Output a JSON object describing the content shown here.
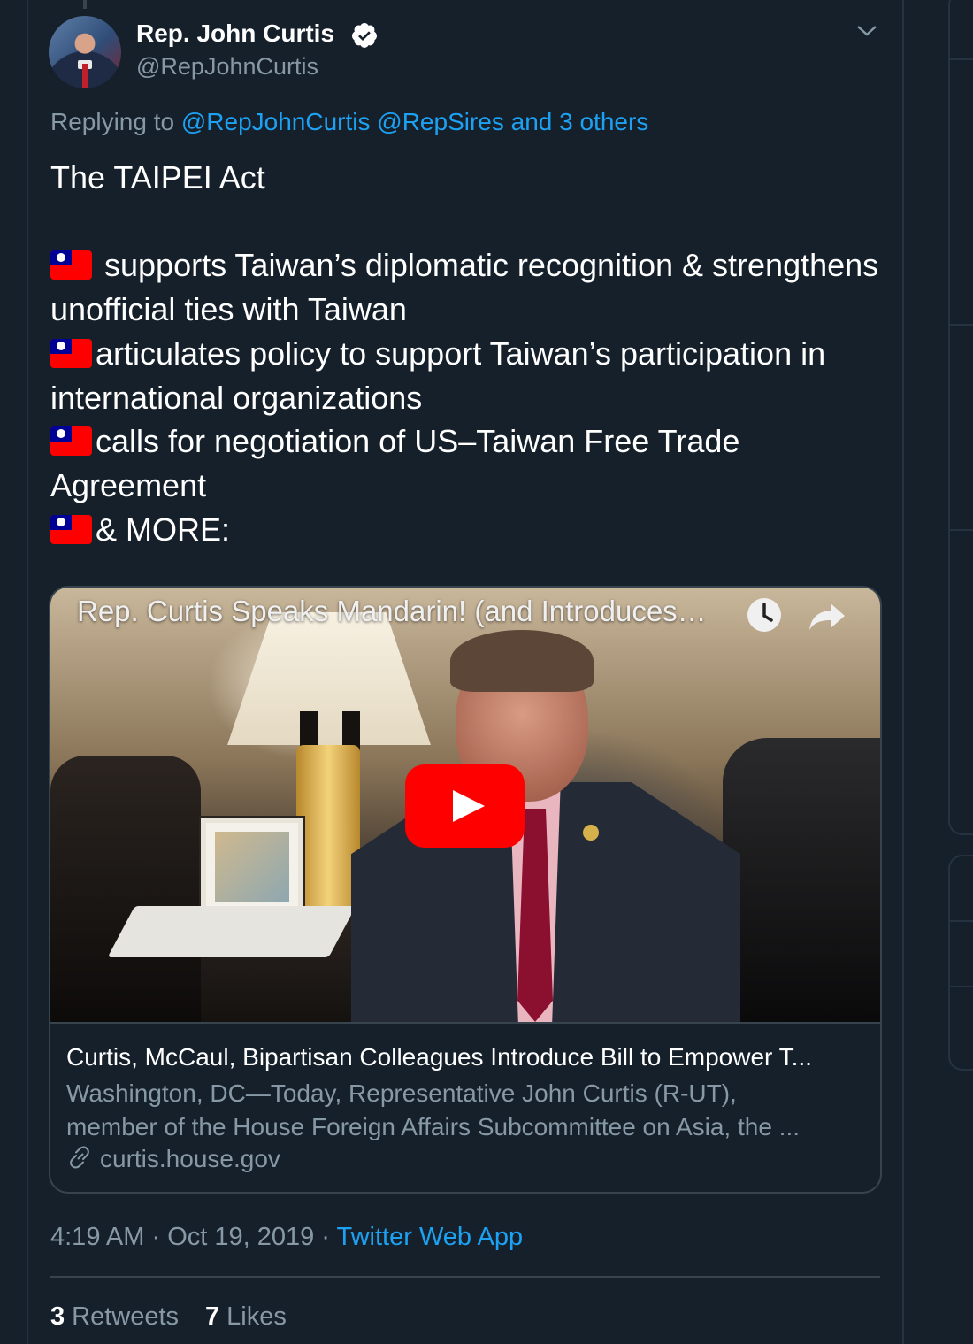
{
  "tweet": {
    "author_name": "Rep. John Curtis",
    "author_handle": "@RepJohnCurtis",
    "replying_prefix": "Replying to ",
    "replying_to": "@RepJohnCurtis @RepSires and 3 others",
    "text_heading": "The TAIPEI Act",
    "lines": {
      "l1": "supports Taiwan’s diplomatic recognition & strengthens unofficial ties with Taiwan",
      "l2": "articulates policy to support Taiwan’s participation in international organizations",
      "l3": "calls for negotiation of US–Taiwan Free Trade Agreement",
      "l4": "& MORE:"
    },
    "flag_icon": "taiwan-flag-emoji",
    "verified_icon": "verified-badge-icon"
  },
  "card": {
    "video_title": "Rep. Curtis Speaks Mandarin! (and Introduces…",
    "title": "Curtis, McCaul, Bipartisan Colleagues Introduce Bill to Empower T...",
    "desc_line1": "Washington, DC—Today, Representative John Curtis (R-UT),",
    "desc_line2": "member of the House Foreign Affairs Subcommittee on Asia, the ...",
    "domain": "curtis.house.gov"
  },
  "meta": {
    "time": "4:19 AM",
    "sep1": " · ",
    "date": "Oct 19, 2019",
    "sep2": " · ",
    "source": "Twitter Web App"
  },
  "stats": {
    "retweets_count": "3",
    "retweets_label": "Retweets",
    "likes_count": "7",
    "likes_label": "Likes"
  },
  "colors": {
    "background": "#15202b",
    "link": "#1da1f2",
    "secondary_text": "#8899a6",
    "border": "#38444d",
    "youtube_red": "#ff0000"
  }
}
